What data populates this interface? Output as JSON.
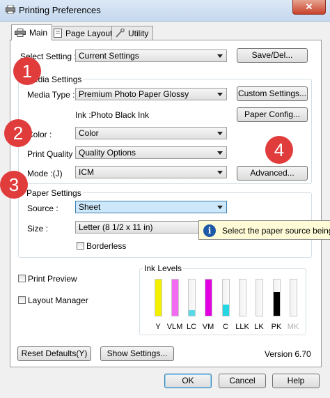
{
  "window": {
    "title": "Printing Preferences",
    "close_glyph": "✕"
  },
  "tabs": [
    {
      "label": "Main",
      "icon": "printer-icon"
    },
    {
      "label": "Page Layout",
      "icon": "page-icon"
    },
    {
      "label": "Utility",
      "icon": "wrench-icon"
    }
  ],
  "select_setting": {
    "label": "Select Setting :",
    "value": "Current Settings",
    "button": "Save/Del..."
  },
  "media": {
    "group_title": "Media Settings",
    "type_label": "Media Type :",
    "type_value": "Premium Photo Paper Glossy",
    "custom_button": "Custom Settings...",
    "ink_text": "Ink :Photo Black Ink",
    "paper_config_button": "Paper Config..."
  },
  "color": {
    "label": "Color :",
    "value": "Color"
  },
  "print_quality": {
    "label": "Print Quality :",
    "value": "Quality Options"
  },
  "mode": {
    "label": "Mode :(J)",
    "value": "ICM",
    "advanced_button": "Advanced..."
  },
  "paper": {
    "group_title": "Paper Settings",
    "source_label": "Source :",
    "source_value": "Sheet",
    "size_label": "Size :",
    "size_value": "Letter (8 1/2 x 11 in)",
    "borderless_label": "Borderless"
  },
  "tooltip": {
    "text": "Select the paper source being"
  },
  "options": {
    "print_preview": "Print Preview",
    "layout_manager": "Layout Manager"
  },
  "ink_levels": {
    "title": "Ink Levels",
    "cartridges": [
      {
        "name": "Y",
        "color": "#f3f000",
        "level": 1.0
      },
      {
        "name": "VLM",
        "color": "#f36bf0",
        "level": 1.0
      },
      {
        "name": "LC",
        "color": "#5ad8e8",
        "level": 0.15
      },
      {
        "name": "VM",
        "color": "#e000e0",
        "level": 1.0
      },
      {
        "name": "C",
        "color": "#22d6e3",
        "level": 0.3
      },
      {
        "name": "LLK",
        "color": "#b8b8b8",
        "level": 0.0
      },
      {
        "name": "LK",
        "color": "#8c8c8c",
        "level": 0.0
      },
      {
        "name": "PK",
        "color": "#000000",
        "level": 0.65
      },
      {
        "name": "MK",
        "color": "#b0b0b0",
        "level": 0.0
      }
    ]
  },
  "footer": {
    "reset_button": "Reset Defaults(Y)",
    "show_settings_button": "Show Settings...",
    "version": "Version 6.70"
  },
  "dialog": {
    "ok": "OK",
    "cancel": "Cancel",
    "help": "Help"
  },
  "callouts": [
    "1",
    "2",
    "3",
    "4"
  ]
}
